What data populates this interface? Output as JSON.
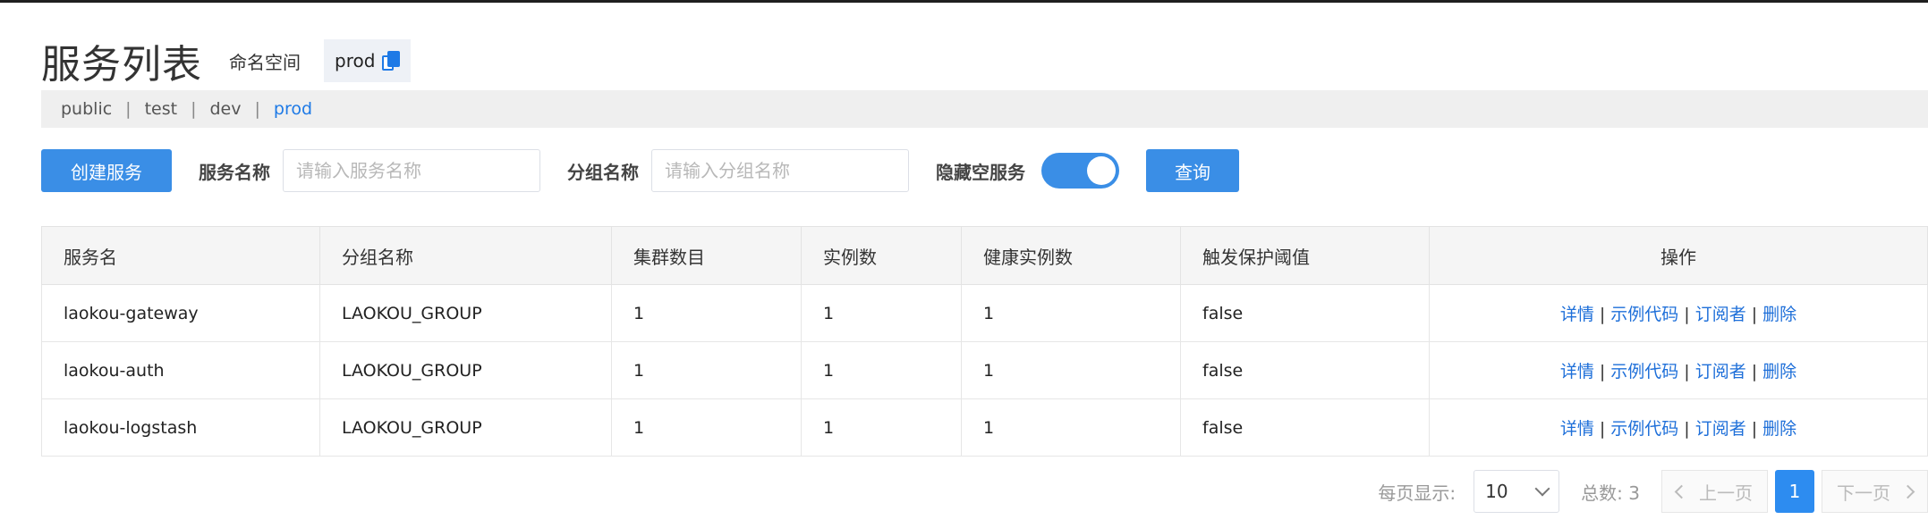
{
  "header": {
    "title": "服务列表",
    "namespace_label": "命名空间",
    "namespace_current": "prod"
  },
  "namespaces": {
    "items": [
      "public",
      "test",
      "dev",
      "prod"
    ],
    "separator": "|",
    "active": "prod"
  },
  "filter": {
    "create_button": "创建服务",
    "service_name_label": "服务名称",
    "service_name_placeholder": "请输入服务名称",
    "group_name_label": "分组名称",
    "group_name_placeholder": "请输入分组名称",
    "hide_empty_label": "隐藏空服务",
    "hide_empty_on": true,
    "query_button": "查询"
  },
  "table": {
    "columns": [
      "服务名",
      "分组名称",
      "集群数目",
      "实例数",
      "健康实例数",
      "触发保护阈值",
      "操作"
    ],
    "rows": [
      [
        "laokou-gateway",
        "LAOKOU_GROUP",
        "1",
        "1",
        "1",
        "false"
      ],
      [
        "laokou-auth",
        "LAOKOU_GROUP",
        "1",
        "1",
        "1",
        "false"
      ],
      [
        "laokou-logstash",
        "LAOKOU_GROUP",
        "1",
        "1",
        "1",
        "false"
      ]
    ],
    "actions": [
      "详情",
      "示例代码",
      "订阅者",
      "删除"
    ],
    "action_separator": "|"
  },
  "pagination": {
    "per_page_label": "每页显示:",
    "per_page_value": "10",
    "total_label": "总数:",
    "total_value": "3",
    "prev_label": "上一页",
    "next_label": "下一页",
    "current_page": "1"
  },
  "colors": {
    "primary": "#3a8ee6",
    "link": "#1e6fd9",
    "ns_bar_bg": "#efefef"
  }
}
